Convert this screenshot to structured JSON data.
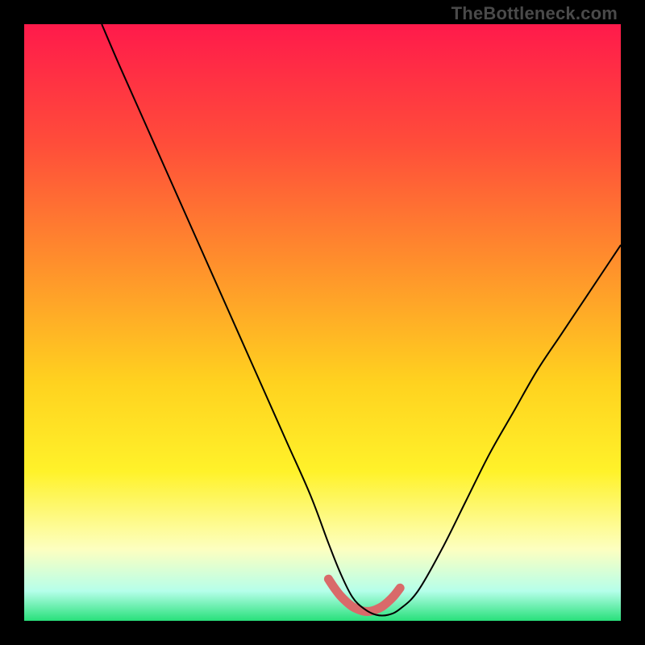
{
  "watermark": "TheBottleneck.com",
  "chart_data": {
    "type": "line",
    "title": "",
    "xlabel": "",
    "ylabel": "",
    "xlim": [
      0,
      100
    ],
    "ylim": [
      0,
      100
    ],
    "grid": false,
    "legend": false,
    "gradient_stops": [
      {
        "offset": 0.0,
        "color": "#ff1a4b"
      },
      {
        "offset": 0.2,
        "color": "#ff4d3a"
      },
      {
        "offset": 0.4,
        "color": "#ff8f2c"
      },
      {
        "offset": 0.6,
        "color": "#ffd21f"
      },
      {
        "offset": 0.75,
        "color": "#fff22a"
      },
      {
        "offset": 0.88,
        "color": "#fdffc0"
      },
      {
        "offset": 0.95,
        "color": "#b6ffea"
      },
      {
        "offset": 1.0,
        "color": "#28e07a"
      }
    ],
    "series": [
      {
        "name": "main-curve",
        "color": "#000000",
        "stroke_width": 2,
        "x": [
          13,
          16,
          20,
          24,
          28,
          32,
          36,
          40,
          44,
          48,
          51,
          53,
          55,
          57,
          59,
          61,
          63,
          66,
          70,
          74,
          78,
          82,
          86,
          90,
          94,
          98,
          100
        ],
        "y": [
          100,
          93,
          84,
          75,
          66,
          57,
          48,
          39,
          30,
          21,
          13,
          8,
          4,
          2,
          1,
          1,
          2,
          5,
          12,
          20,
          28,
          35,
          42,
          48,
          54,
          60,
          63
        ]
      },
      {
        "name": "highlight-band",
        "color": "#d96a6a",
        "stroke_width": 11,
        "stroke_linecap": "round",
        "x": [
          51,
          52,
          53,
          54,
          55,
          56,
          57,
          58,
          59,
          60,
          61,
          62,
          63
        ],
        "y": [
          7.0,
          5.5,
          4.2,
          3.2,
          2.4,
          1.9,
          1.6,
          1.6,
          1.9,
          2.4,
          3.2,
          4.2,
          5.5
        ]
      }
    ]
  }
}
